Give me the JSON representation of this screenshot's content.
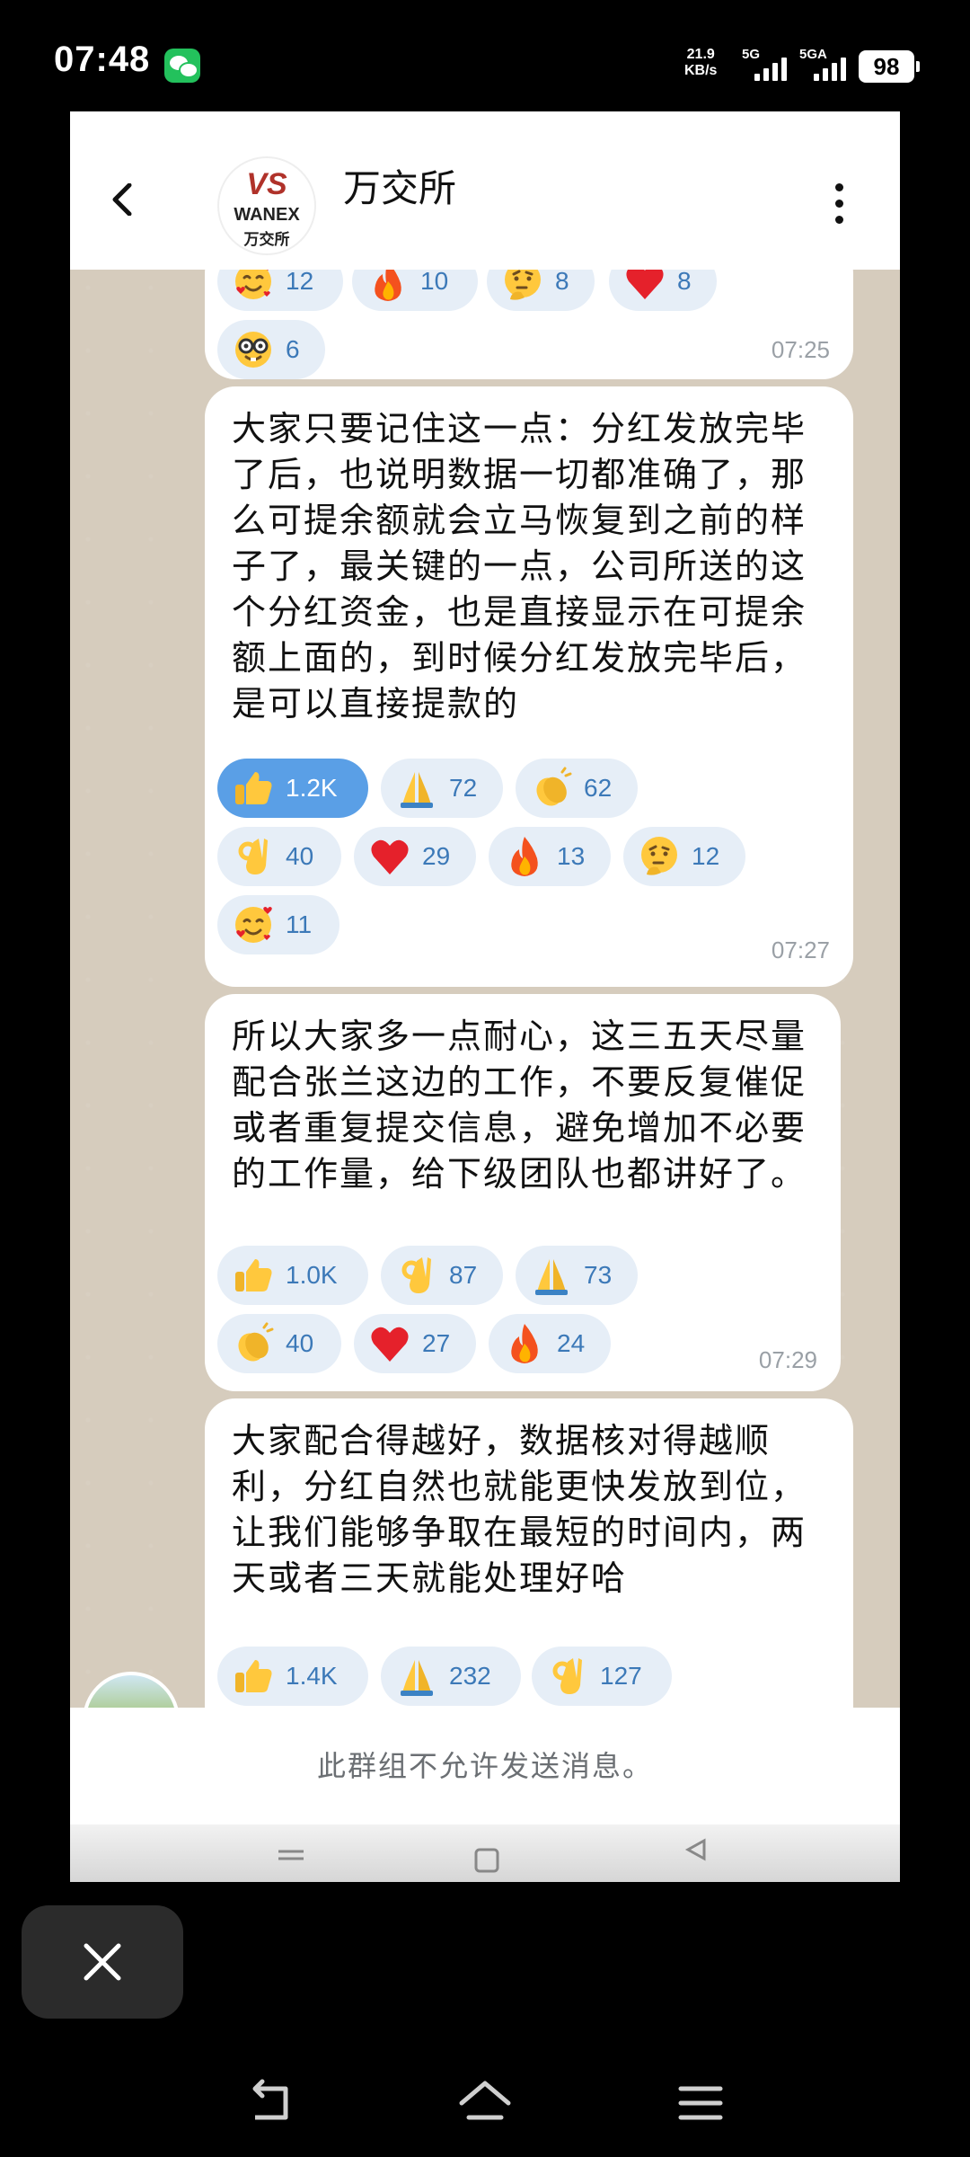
{
  "status_bar": {
    "time": "07:48",
    "speed_value": "21.9",
    "speed_unit": "KB/s",
    "network_1": "5G",
    "network_2": "5GA",
    "battery": "98"
  },
  "header": {
    "title": "万交所",
    "logo_mark": "VS",
    "logo_name": "WANEX",
    "logo_sub": "万交所"
  },
  "messages": [
    {
      "time": "07:25",
      "reactions": [
        {
          "emoji": "smiling-face-hearts",
          "count": "12"
        },
        {
          "emoji": "fire",
          "count": "10"
        },
        {
          "emoji": "thinking-face",
          "count": "8"
        },
        {
          "emoji": "red-heart",
          "count": "8"
        },
        {
          "emoji": "nerd-face",
          "count": "6"
        }
      ]
    },
    {
      "text": "大家只要记住这一点：分红发放完毕了后，也说明数据一切都准确了，那么可提余额就会立马恢复到之前的样子了，最关键的一点，公司所送的这个分红资金，也是直接显示在可提余额上面的，到时候分红发放完毕后，是可以直接提款的",
      "time": "07:27",
      "reactions": [
        {
          "emoji": "thumbs-up",
          "count": "1.2K",
          "active": true
        },
        {
          "emoji": "folded-hands",
          "count": "72"
        },
        {
          "emoji": "clapping-hands",
          "count": "62"
        },
        {
          "emoji": "ok-hand",
          "count": "40"
        },
        {
          "emoji": "red-heart",
          "count": "29"
        },
        {
          "emoji": "fire",
          "count": "13"
        },
        {
          "emoji": "thinking-face",
          "count": "12"
        },
        {
          "emoji": "smiling-face-hearts",
          "count": "11"
        }
      ]
    },
    {
      "text": "所以大家多一点耐心，这三五天尽量配合张兰这边的工作，不要反复催促或者重复提交信息，避免增加不必要的工作量，给下级团队也都讲好了。",
      "time": "07:29",
      "reactions": [
        {
          "emoji": "thumbs-up",
          "count": "1.0K"
        },
        {
          "emoji": "ok-hand",
          "count": "87"
        },
        {
          "emoji": "folded-hands",
          "count": "73"
        },
        {
          "emoji": "clapping-hands",
          "count": "40"
        },
        {
          "emoji": "red-heart",
          "count": "27"
        },
        {
          "emoji": "fire",
          "count": "24"
        }
      ]
    },
    {
      "text": "大家配合得越好，数据核对得越顺利，分红自然也就能更快发放到位，让我们能够争取在最短的时间内，两天或者三天就能处理好哈",
      "reactions": [
        {
          "emoji": "thumbs-up",
          "count": "1.4K"
        },
        {
          "emoji": "folded-hands",
          "count": "232"
        },
        {
          "emoji": "ok-hand",
          "count": "127"
        }
      ]
    }
  ],
  "compose_notice": "此群组不允许发送消息。",
  "system_nav": [
    "back-icon",
    "home-icon",
    "menu-icon"
  ],
  "colors": {
    "chat_background": "#d6ccbd",
    "reaction_bg": "#e6eef7",
    "reaction_active": "#5a9fe6",
    "reaction_text": "#3c79b8"
  }
}
